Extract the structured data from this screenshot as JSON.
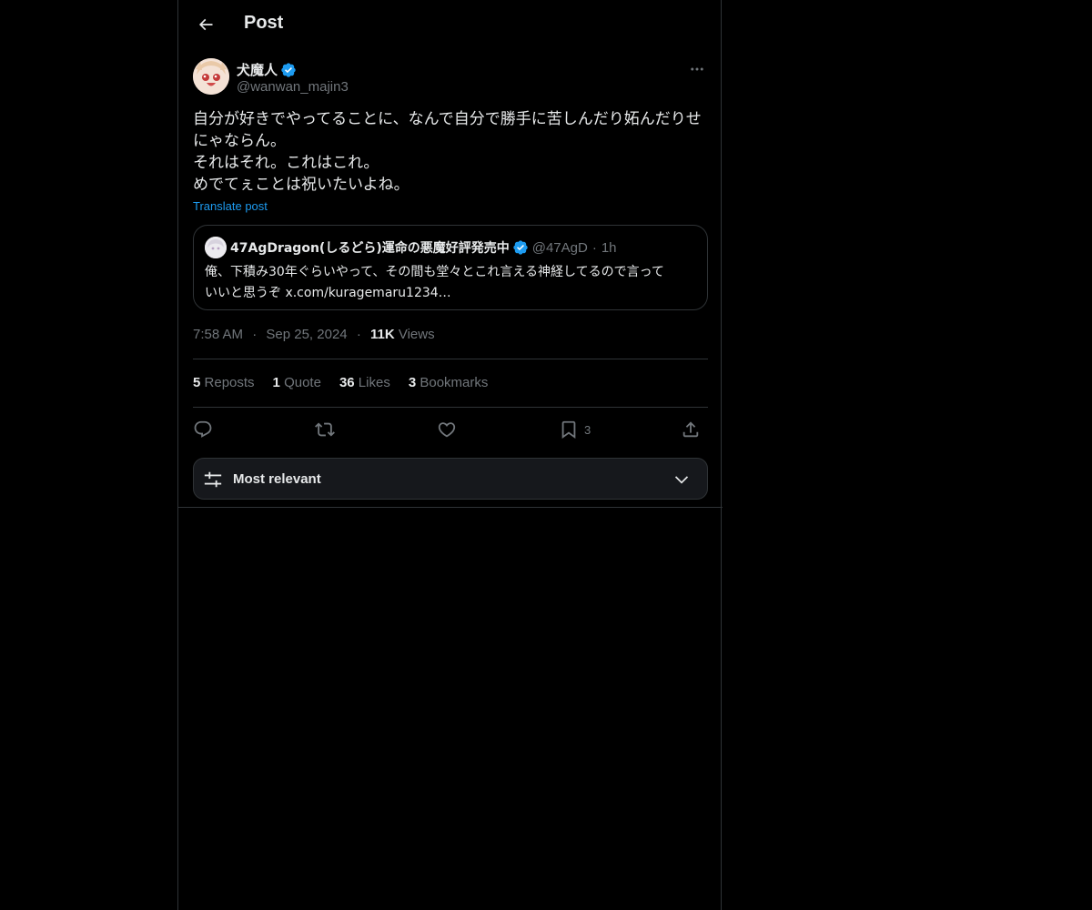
{
  "header": {
    "title": "Post"
  },
  "post": {
    "author_name": "犬魔人",
    "author_handle": "@wanwan_majin3",
    "text_lines": [
      "自分が好きでやってることに、なんで自分で勝手に苦しんだり妬んだりせ",
      "にゃならん。",
      "それはそれ。これはこれ。",
      "めでてぇことは祝いたいよね。"
    ],
    "translate_label": "Translate post",
    "time": "7:58 AM",
    "date": "Sep 25, 2024",
    "views_count": "11K",
    "views_label": "Views",
    "dot": "·"
  },
  "quote": {
    "author_name": "47AgDragon(しるどら)運命の悪魔好評発売中",
    "author_handle": "@47AgD",
    "time": "1h",
    "dot": "·",
    "text_lines": [
      "俺、下積み30年ぐらいやって、その間も堂々とこれ言える神経してるので言って",
      "いいと思うぞ x.com/kuragemaru1234…"
    ]
  },
  "stats": {
    "reposts_count": "5",
    "reposts_label": "Reposts",
    "quotes_count": "1",
    "quotes_label": "Quote",
    "likes_count": "36",
    "likes_label": "Likes",
    "bookmarks_count": "3",
    "bookmarks_label": "Bookmarks"
  },
  "actions": {
    "bookmark_count": "3"
  },
  "sort": {
    "label": "Most relevant"
  },
  "colors": {
    "background": "#000000",
    "text": "#e7e9ea",
    "muted": "#71767b",
    "accent": "#1d9bf0",
    "border": "#2f3336"
  },
  "icons": {
    "back": "arrow-left-icon",
    "verified": "verified-badge-icon",
    "more": "more-horizontal-icon",
    "reply": "reply-icon",
    "repost": "repost-icon",
    "like": "heart-icon",
    "bookmark": "bookmark-icon",
    "share": "share-icon",
    "sort": "sliders-icon",
    "chevron": "chevron-down-icon"
  }
}
